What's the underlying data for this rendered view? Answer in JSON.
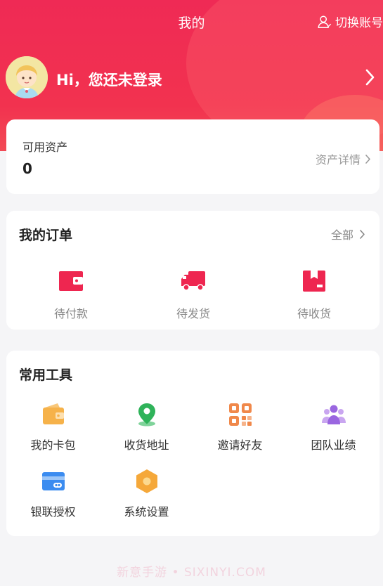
{
  "header": {
    "title": "我的",
    "switch_account": "切换账号",
    "greeting": "Hi，您还未登录"
  },
  "assets": {
    "label": "可用资产",
    "value": "0",
    "detail_link": "资产详情"
  },
  "orders": {
    "title": "我的订单",
    "all_link": "全部",
    "items": [
      {
        "label": "待付款",
        "icon": "wallet-icon"
      },
      {
        "label": "待发货",
        "icon": "truck-icon"
      },
      {
        "label": "待收货",
        "icon": "package-icon"
      }
    ]
  },
  "tools": {
    "title": "常用工具",
    "items": [
      {
        "label": "我的卡包",
        "icon": "card-wallet-icon"
      },
      {
        "label": "收货地址",
        "icon": "location-icon"
      },
      {
        "label": "邀请好友",
        "icon": "qr-code-icon"
      },
      {
        "label": "团队业绩",
        "icon": "team-icon"
      },
      {
        "label": "银联授权",
        "icon": "bank-card-icon"
      },
      {
        "label": "系统设置",
        "icon": "settings-icon"
      }
    ]
  },
  "watermark": "新意手游 • SIXINYI.COM",
  "colors": {
    "brand_red": "#ef2a55",
    "order_icon_red": "#ee2650"
  }
}
